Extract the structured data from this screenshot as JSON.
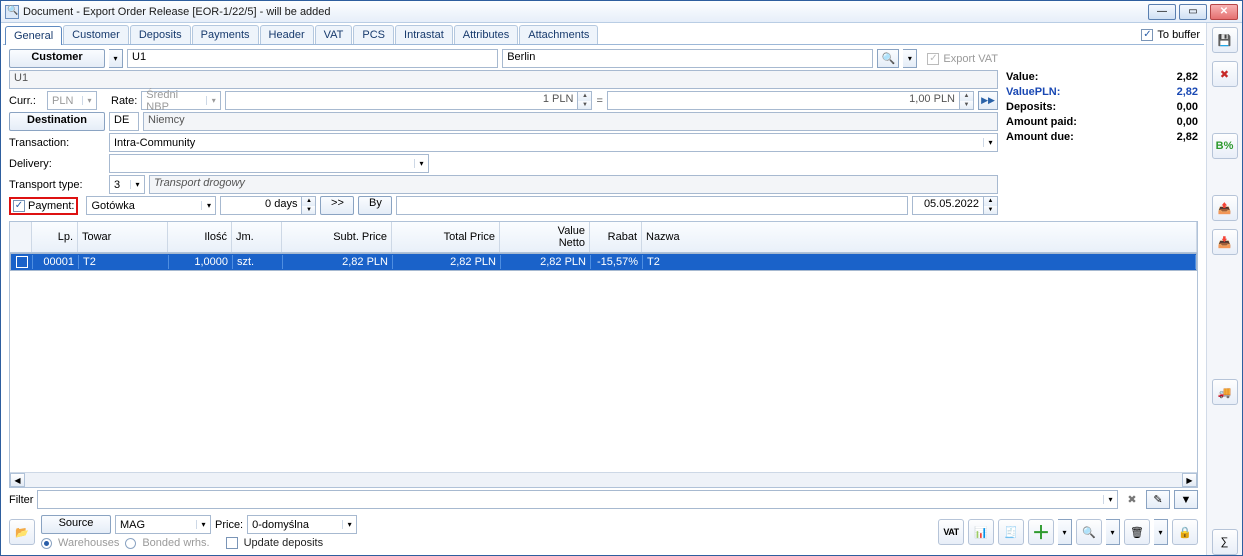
{
  "window": {
    "title": "Document - Export Order Release [EOR-1/22/5]  - will be added"
  },
  "tabs": {
    "items": [
      "General",
      "Customer",
      "Deposits",
      "Payments",
      "Header",
      "VAT",
      "PCS",
      "Intrastat",
      "Attributes",
      "Attachments"
    ],
    "to_buffer": "To buffer"
  },
  "form": {
    "customer_btn": "Customer",
    "customer_code": "U1",
    "customer_city": "Berlin",
    "customer_below": "U1",
    "export_vat": "Export VAT",
    "curr_label": "Curr.:",
    "curr_value": "PLN",
    "rate_label": "Rate:",
    "rate_value": "Średni NBP",
    "rate_num": "1 PLN",
    "rate_amt": "1,00 PLN",
    "destination_btn": "Destination",
    "dest_code": "DE",
    "dest_name": "Niemcy",
    "transaction_label": "Transaction:",
    "transaction_value": "Intra-Community",
    "delivery_label": "Delivery:",
    "delivery_value": "",
    "transport_label": "Transport type:",
    "transport_value": "3",
    "transport_name": "Transport drogowy",
    "payment_label": "Payment:",
    "payment_value": "Gotówka",
    "days_value": "0 days",
    "forward_btn": ">>",
    "by_btn": "By",
    "date_value": "05.05.2022"
  },
  "totals": {
    "value_l": "Value:",
    "value_v": "2,82",
    "valuepln_l": "ValuePLN:",
    "valuepln_v": "2,82",
    "deposits_l": "Deposits:",
    "deposits_v": "0,00",
    "paid_l": "Amount paid:",
    "paid_v": "0,00",
    "due_l": "Amount due:",
    "due_v": "2,82"
  },
  "grid": {
    "headers": {
      "lp": "Lp.",
      "towar": "Towar",
      "ilosc": "Ilość",
      "jm": "Jm.",
      "subt": "Subt. Price",
      "total": "Total Price",
      "value": "Value",
      "netto": "Netto",
      "rabat": "Rabat",
      "nazwa": "Nazwa"
    },
    "row": {
      "lp": "00001",
      "towar": "T2",
      "ilosc": "1,0000",
      "jm": "szt.",
      "subt": "2,82 PLN",
      "total": "2,82 PLN",
      "valnetto": "2,82 PLN",
      "rabat": "-15,57%",
      "nazwa": "T2"
    }
  },
  "filter": {
    "label": "Filter"
  },
  "footer": {
    "source_btn": "Source",
    "source_value": "MAG",
    "price_label": "Price:",
    "price_value": "0-domyślna",
    "warehouses": "Warehouses",
    "bonded": "Bonded wrhs.",
    "update_dep": "Update deposits",
    "vat_btn": "VAT"
  }
}
